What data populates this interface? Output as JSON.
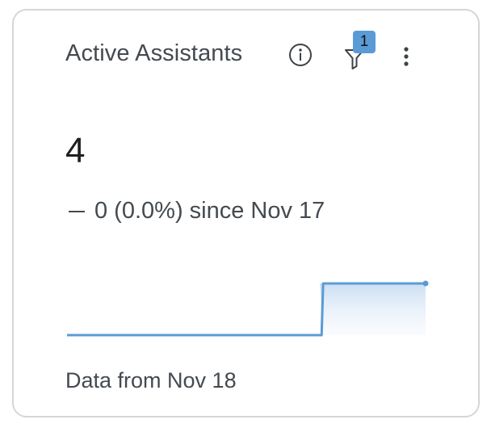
{
  "widget": {
    "title": "Active Assistants",
    "info_icon": "info-circle-icon",
    "filter_icon": "filter-funnel-icon",
    "filter_badge": "1",
    "more_icon": "more-vertical-icon",
    "value": "4",
    "change_text": "0 (0.0%) since Nov 17",
    "footer": "Data from Nov 18",
    "accent_color": "#5b9bd5"
  },
  "chart_data": {
    "type": "area",
    "values": [
      3,
      3,
      3,
      3,
      3,
      4,
      4,
      4
    ],
    "ylim": [
      3,
      4
    ]
  }
}
